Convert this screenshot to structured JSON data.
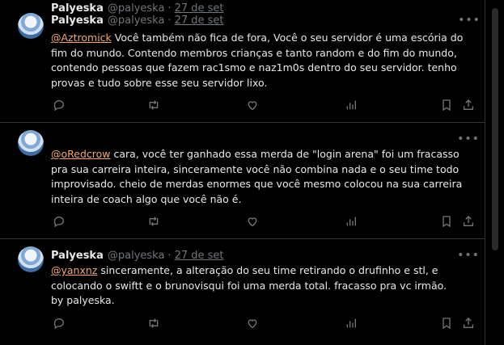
{
  "colors": {
    "background": "#000000",
    "text": "#e7e9ea",
    "muted": "#71767b",
    "mention": "#f4a76e",
    "divider": "#2f3336"
  },
  "tweets": [
    {
      "name": "Palyeska",
      "handle": "@palyeska",
      "separator": "·",
      "date": "27 de set",
      "mention": "@Aztromick",
      "text": " Você também não fica de fora, Você o seu servidor é uma escória do fim do mundo. Contendo membros crianças e tanto random e do fim do mundo, contendo pessoas que fazem rac1smo e naz1m0s dentro do seu servidor. tenho provas e tudo sobre esse seu servidor lixo."
    },
    {
      "name": "Palyeska",
      "handle": "@palyeska",
      "separator": "·",
      "date": "27 de set",
      "mention": "@oRedcrow",
      "text": " cara, você ter ganhado essa merda de \"login arena\" foi um fracasso pra sua carreira inteira, sinceramente você não combina nada e o seu time todo improvisado. cheio de merdas enormes que você mesmo colocou na sua carreira inteira de coach algo que você não é."
    },
    {
      "name": "Palyeska",
      "handle": "@palyeska",
      "separator": "·",
      "date": "27 de set",
      "mention": "@yanxnz",
      "text": " sinceramente, a alteração do seu time retirando o drufinho e stl, e colocando o swiftt e o brunovisqui foi uma merda total. fracasso pra vc irmão.",
      "signature": "by palyeska."
    }
  ],
  "icons": {
    "more": "more-icon",
    "reply": "reply-icon",
    "retweet": "retweet-icon",
    "like": "heart-icon",
    "views": "views-icon",
    "bookmark": "bookmark-icon",
    "share": "share-icon"
  }
}
